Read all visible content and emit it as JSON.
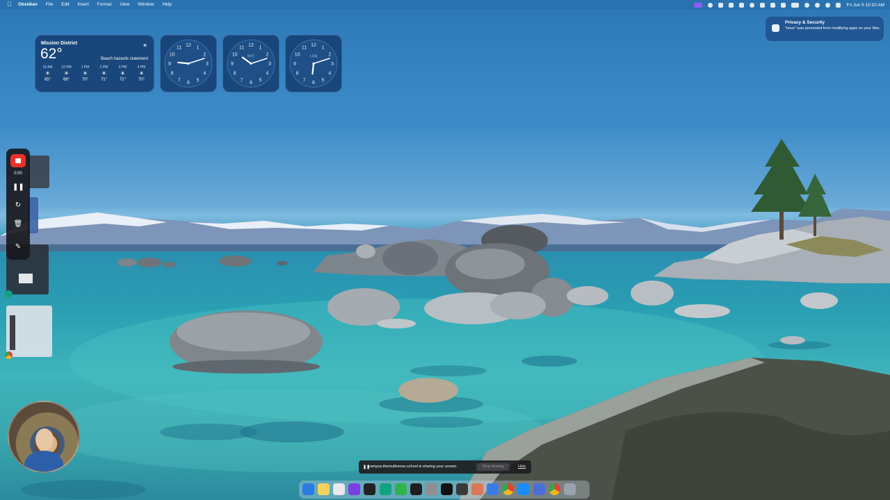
{
  "menubar": {
    "app_name": "Obsidian",
    "menus": [
      "File",
      "Edit",
      "Insert",
      "Format",
      "View",
      "Window",
      "Help"
    ],
    "clock": "Fri Jun 5  10:10 AM"
  },
  "weather": {
    "city": "Mission District",
    "temperature": "62°",
    "condition": "Beach hazards statement",
    "forecast": [
      {
        "time": "11 AM",
        "temp": "65°"
      },
      {
        "time": "12 PM",
        "temp": "69°"
      },
      {
        "time": "1 PM",
        "temp": "70°"
      },
      {
        "time": "2 PM",
        "temp": "71°"
      },
      {
        "time": "3 PM",
        "temp": "71°"
      },
      {
        "time": "4 PM",
        "temp": "70°"
      }
    ]
  },
  "clocks": [
    {
      "city": "",
      "hour": 9,
      "minute": 12
    },
    {
      "city": "NYC",
      "hour": 10,
      "minute": 12
    },
    {
      "city": "LON",
      "hour": 6,
      "minute": 12
    }
  ],
  "notification": {
    "title": "Privacy & Security",
    "body": "\"tmux\" was prevented from modifying apps on your Mac."
  },
  "recorder": {
    "elapsed": "0:00"
  },
  "screen_share": {
    "message": "campus.themultiverse.school is sharing your screen.",
    "stop_label": "Stop sharing",
    "hide_label": "Hide"
  },
  "dock": {
    "apps": [
      "finder-icon",
      "notes-icon",
      "launchpad-icon",
      "obsidian-icon",
      "terminal-icon",
      "chatgpt-icon",
      "numbers-icon",
      "cursor-icon",
      "settings-icon",
      "capcut-icon",
      "activity-monitor-icon",
      "claude-icon",
      "keynote-icon",
      "chrome-icon",
      "safari-icon",
      "preview-icon",
      "chrome-dev-icon",
      "trash-icon"
    ],
    "colors": [
      "#2a7be4",
      "#f4d35e",
      "#e9e9ee",
      "#7b3fe4",
      "#222222",
      "#10a37f",
      "#2fb34a",
      "#1e1e1e",
      "#8e8e93",
      "#111111",
      "#3a3a3a",
      "#d97757",
      "#3a7be8",
      "#e34133",
      "#1a8cff",
      "#4a6fd8",
      "#f2b620",
      "#9aa3ad"
    ]
  }
}
